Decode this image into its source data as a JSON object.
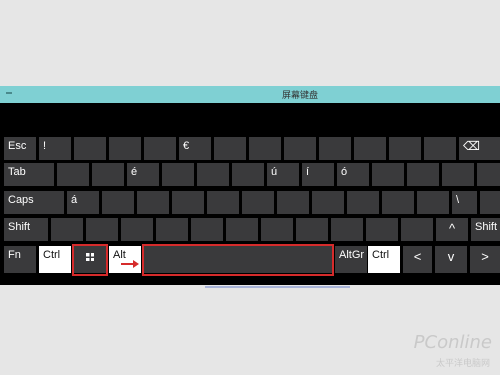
{
  "window": {
    "title": "屏幕键盘"
  },
  "keys": {
    "esc": "Esc",
    "exclam": "!",
    "euro": "€",
    "tab": "Tab",
    "e_acute": "é",
    "u_acute": "ú",
    "i_acute": "í",
    "o_acute": "ó",
    "caps": "Caps",
    "a_acute": "á",
    "backslash": "\\",
    "shift_left": "Shift",
    "shift_right": "Shift",
    "up": "^",
    "fn": "Fn",
    "ctrl_left": "Ctrl",
    "alt": "Alt",
    "altgr": "AltGr",
    "ctrl_right": "Ctrl",
    "left": "<",
    "down": "v",
    "right": ">"
  },
  "watermark": {
    "brand": "PConline",
    "sub": "太平洋电脑网"
  },
  "colors": {
    "highlight": "#d62b2b",
    "titlebar": "#7fd0d3",
    "key": "#3a3a3c"
  }
}
